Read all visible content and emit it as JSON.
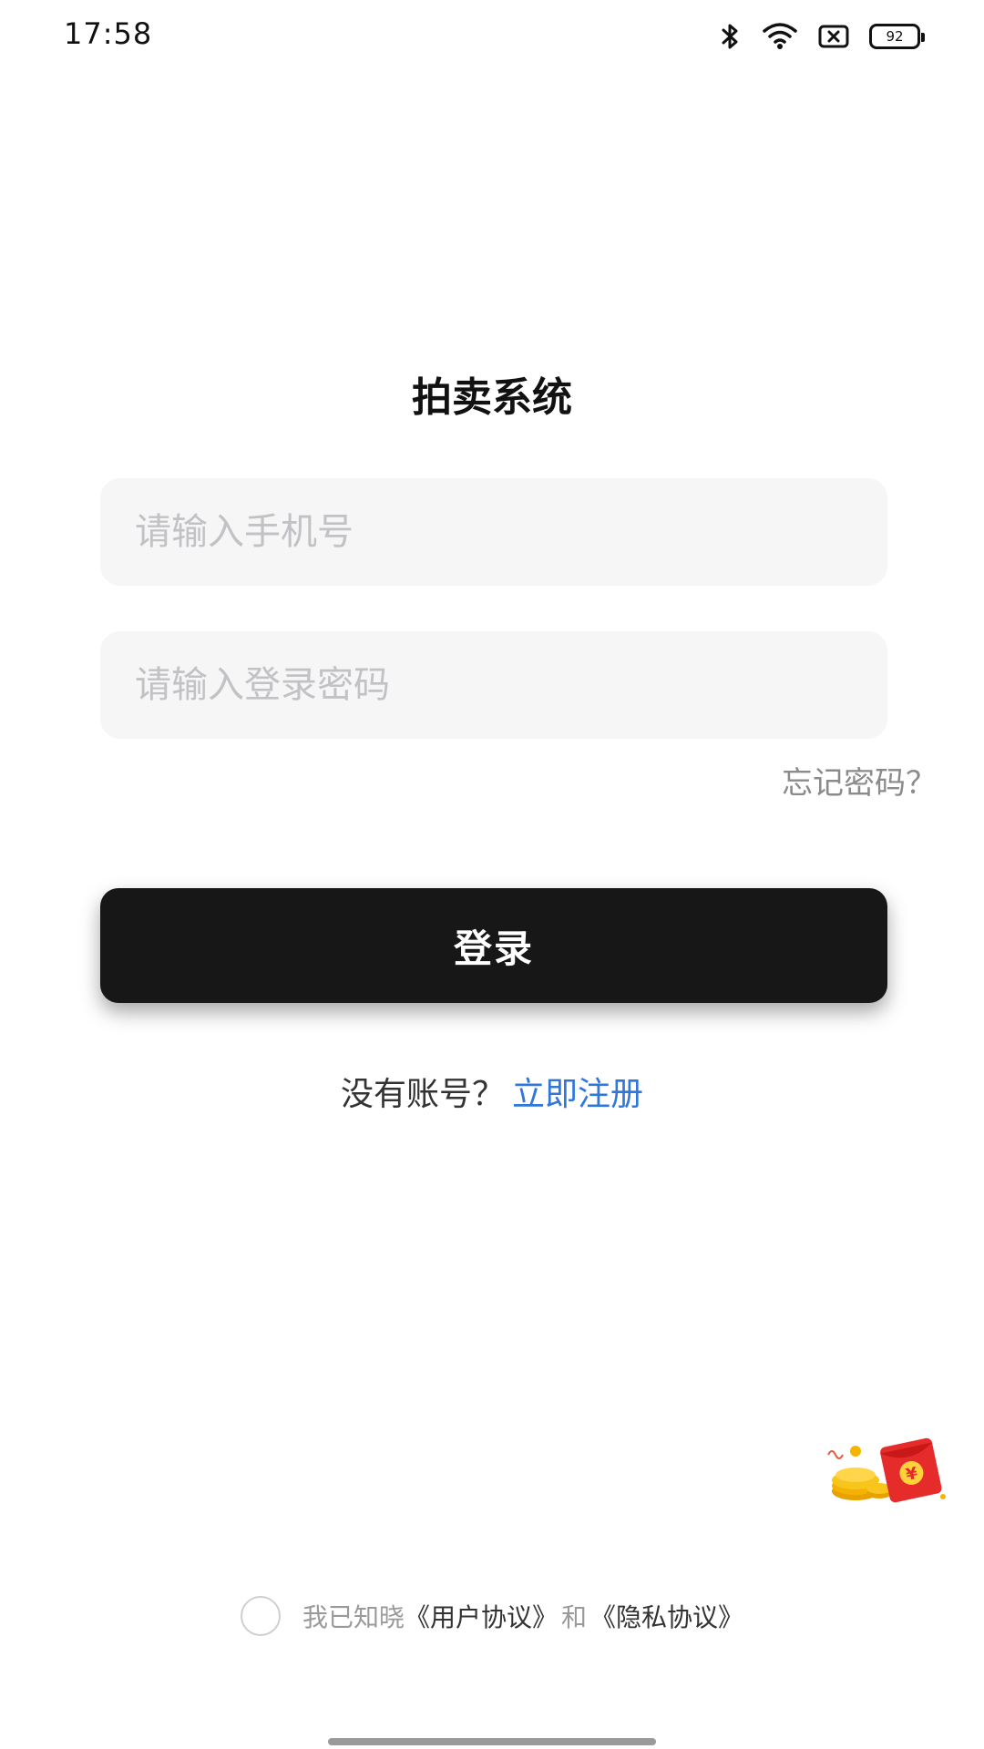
{
  "status_bar": {
    "time": "17:58",
    "battery_level": "92",
    "icons": [
      "bluetooth-icon",
      "wifi-icon",
      "sim-off-icon",
      "battery-icon"
    ]
  },
  "app": {
    "title": "拍卖系统"
  },
  "login_form": {
    "phone_placeholder": "请输入手机号",
    "password_placeholder": "请输入登录密码",
    "forgot_password": "忘记密码？",
    "login_button": "登录"
  },
  "register": {
    "prompt": "没有账号？",
    "link": "立即注册"
  },
  "agreement": {
    "checked": false,
    "prefix": "我已知晓",
    "user_agreement": "《用户协议》",
    "and": "和",
    "privacy_agreement": "《隐私协议》"
  },
  "floating": {
    "icon": "red-packet-icon",
    "symbol": "¥"
  },
  "colors": {
    "accent_link": "#2f77d8",
    "button_bg": "#171717",
    "input_bg": "#f6f6f6"
  }
}
